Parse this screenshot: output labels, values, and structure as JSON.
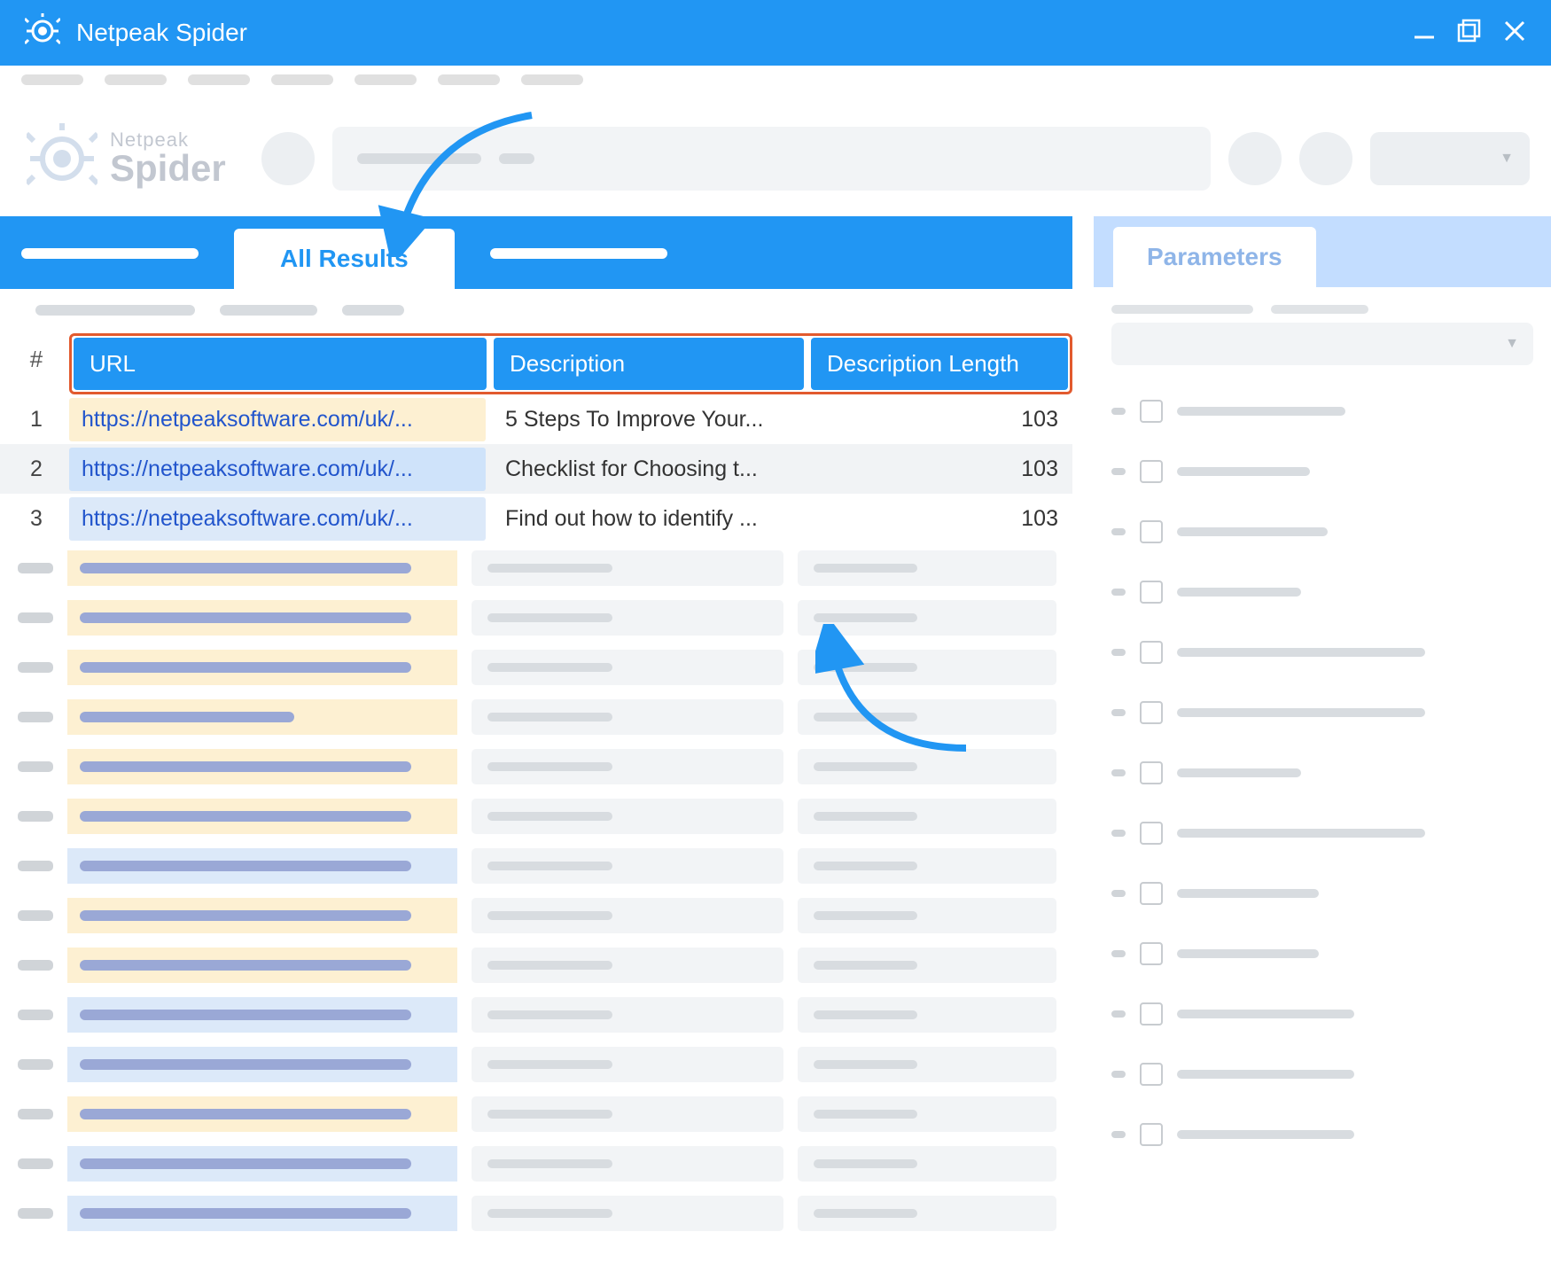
{
  "titlebar": {
    "title": "Netpeak Spider"
  },
  "logo": {
    "top": "Netpeak",
    "bot": "Spider"
  },
  "tabs": {
    "active": "All Results"
  },
  "table": {
    "headers": {
      "num": "#",
      "url": "URL",
      "desc": "Description",
      "len": "Description Length"
    },
    "rows": [
      {
        "num": "1",
        "url": "https://netpeaksoftware.com/uk/...",
        "desc": "5 Steps To Improve Your...",
        "len": "103"
      },
      {
        "num": "2",
        "url": "https://netpeaksoftware.com/uk/...",
        "desc": "Checklist for Choosing t...",
        "len": "103"
      },
      {
        "num": "3",
        "url": "https://netpeaksoftware.com/uk/...",
        "desc": "Find out how to identify ...",
        "len": "103"
      }
    ]
  },
  "right": {
    "tab": "Parameters"
  }
}
